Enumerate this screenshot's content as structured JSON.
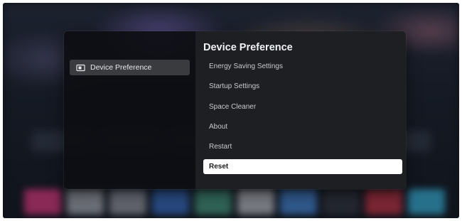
{
  "sidebar": {
    "items": [
      {
        "label": "Device Preference",
        "icon": "device-preference-icon",
        "selected": true
      }
    ]
  },
  "panel": {
    "title": "Device Preference",
    "items": [
      {
        "label": "Energy Saving Settings",
        "focused": false
      },
      {
        "label": "Startup Settings",
        "focused": false
      },
      {
        "label": "Space Cleaner",
        "focused": false
      },
      {
        "label": "About",
        "focused": false
      },
      {
        "label": "Restart",
        "focused": false
      },
      {
        "label": "Reset",
        "focused": true
      }
    ]
  },
  "colors": {
    "focus_highlight": "#ffffff",
    "sidebar_selected": "#3a3b3f",
    "panel_background": "#1e1f23",
    "sidebar_background": "#0d0e12"
  }
}
